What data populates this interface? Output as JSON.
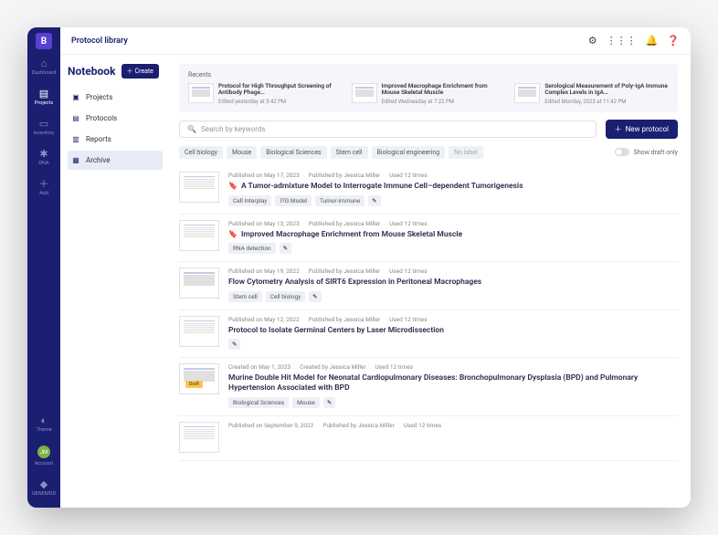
{
  "topbar": {
    "title": "Protocol library"
  },
  "rail": {
    "logo": "B",
    "items": [
      {
        "icon": "⌂",
        "label": "Dashboard"
      },
      {
        "icon": "▤",
        "label": "Projects"
      },
      {
        "icon": "▭",
        "label": "Inventory"
      },
      {
        "icon": "✱",
        "label": "DNA"
      },
      {
        "icon": "＋",
        "label": "Add"
      }
    ],
    "bottom": [
      {
        "icon": "◐",
        "label": "Theme"
      },
      {
        "icon": "JM",
        "label": "Account"
      },
      {
        "icon": "◆",
        "label": "GENEMOD"
      }
    ]
  },
  "sidepanel": {
    "title": "Notebook",
    "create_label": "Create",
    "nav": [
      {
        "icon": "▣",
        "label": "Projects"
      },
      {
        "icon": "▤",
        "label": "Protocols"
      },
      {
        "icon": "▥",
        "label": "Reports"
      },
      {
        "icon": "▦",
        "label": "Archive"
      }
    ]
  },
  "recents": {
    "label": "Recents",
    "items": [
      {
        "title": "Protocol for High Throughput Screening of Antibody Phage…",
        "meta": "Edited yesterday at 3:42 PM"
      },
      {
        "title": "Improved Macrophage Enrichment from Mouse Skeletal Muscle",
        "meta": "Edited Wednesday at 7:22 PM"
      },
      {
        "title": "Serological Measurement of Poly-IgA Immune Complex Levels in IgA…",
        "meta": "Edited Monday, 2023 at 11:42 PM"
      }
    ]
  },
  "search": {
    "placeholder": "Search by keywords"
  },
  "new_protocol_label": "New protocol",
  "filters": [
    "Cell biology",
    "Mouse",
    "Biological Sciences",
    "Stem cell",
    "Biological engineering"
  ],
  "no_label": "No label",
  "draft_toggle_label": "Show draft only",
  "protocols": [
    {
      "bookmark": true,
      "meta": [
        "Published on May 17, 2023",
        "Published by Jessica Miller",
        "Used 12 times"
      ],
      "title": "A Tumor-admixture Model to Interrogate Immune Cell–dependent Tumorigenesis",
      "tags": [
        "Cell Interplay",
        "ITG Model",
        "Tumor-immune"
      ],
      "edit": true
    },
    {
      "bookmark": true,
      "meta": [
        "Published on May 13, 2023",
        "Published by Jessica Miller",
        "Used 12 times"
      ],
      "title": "Improved Macrophage Enrichment from Mouse Skeletal Muscle",
      "tags": [
        "RNA detection"
      ],
      "edit": true
    },
    {
      "bookmark": false,
      "meta": [
        "Published on May 19, 2022",
        "Published by Jessica Miller",
        "Used 12 times"
      ],
      "title": "Flow Cytometry Analysis of SIRT6 Expression in Peritoneal Macrophages",
      "tags": [
        "Stem cell",
        "Cell biology"
      ],
      "edit": true
    },
    {
      "bookmark": false,
      "meta": [
        "Published on May 12, 2022",
        "Published by Jessica Miller",
        "Used 12 times"
      ],
      "title": "Protocol to Isolate Germinal Centers by Laser Microdissection",
      "tags": [],
      "edit": true
    },
    {
      "bookmark": false,
      "draft": true,
      "meta": [
        "Created on May 1, 2023",
        "Created by Jessica Miller",
        "Used 12 times"
      ],
      "title": "Murine Double Hit Model for Neonatal Cardiopulmonary Diseases: Bronchopulmonary Dysplasia (BPD) and Pulmonary Hypertension Associated with BPD",
      "tags": [
        "Biological Sciences",
        "Mouse"
      ],
      "edit": true
    },
    {
      "bookmark": false,
      "meta": [
        "Published on September 9, 2022",
        "Published by Jessica Miller",
        "Used 12 times"
      ],
      "title": "",
      "tags": []
    }
  ]
}
